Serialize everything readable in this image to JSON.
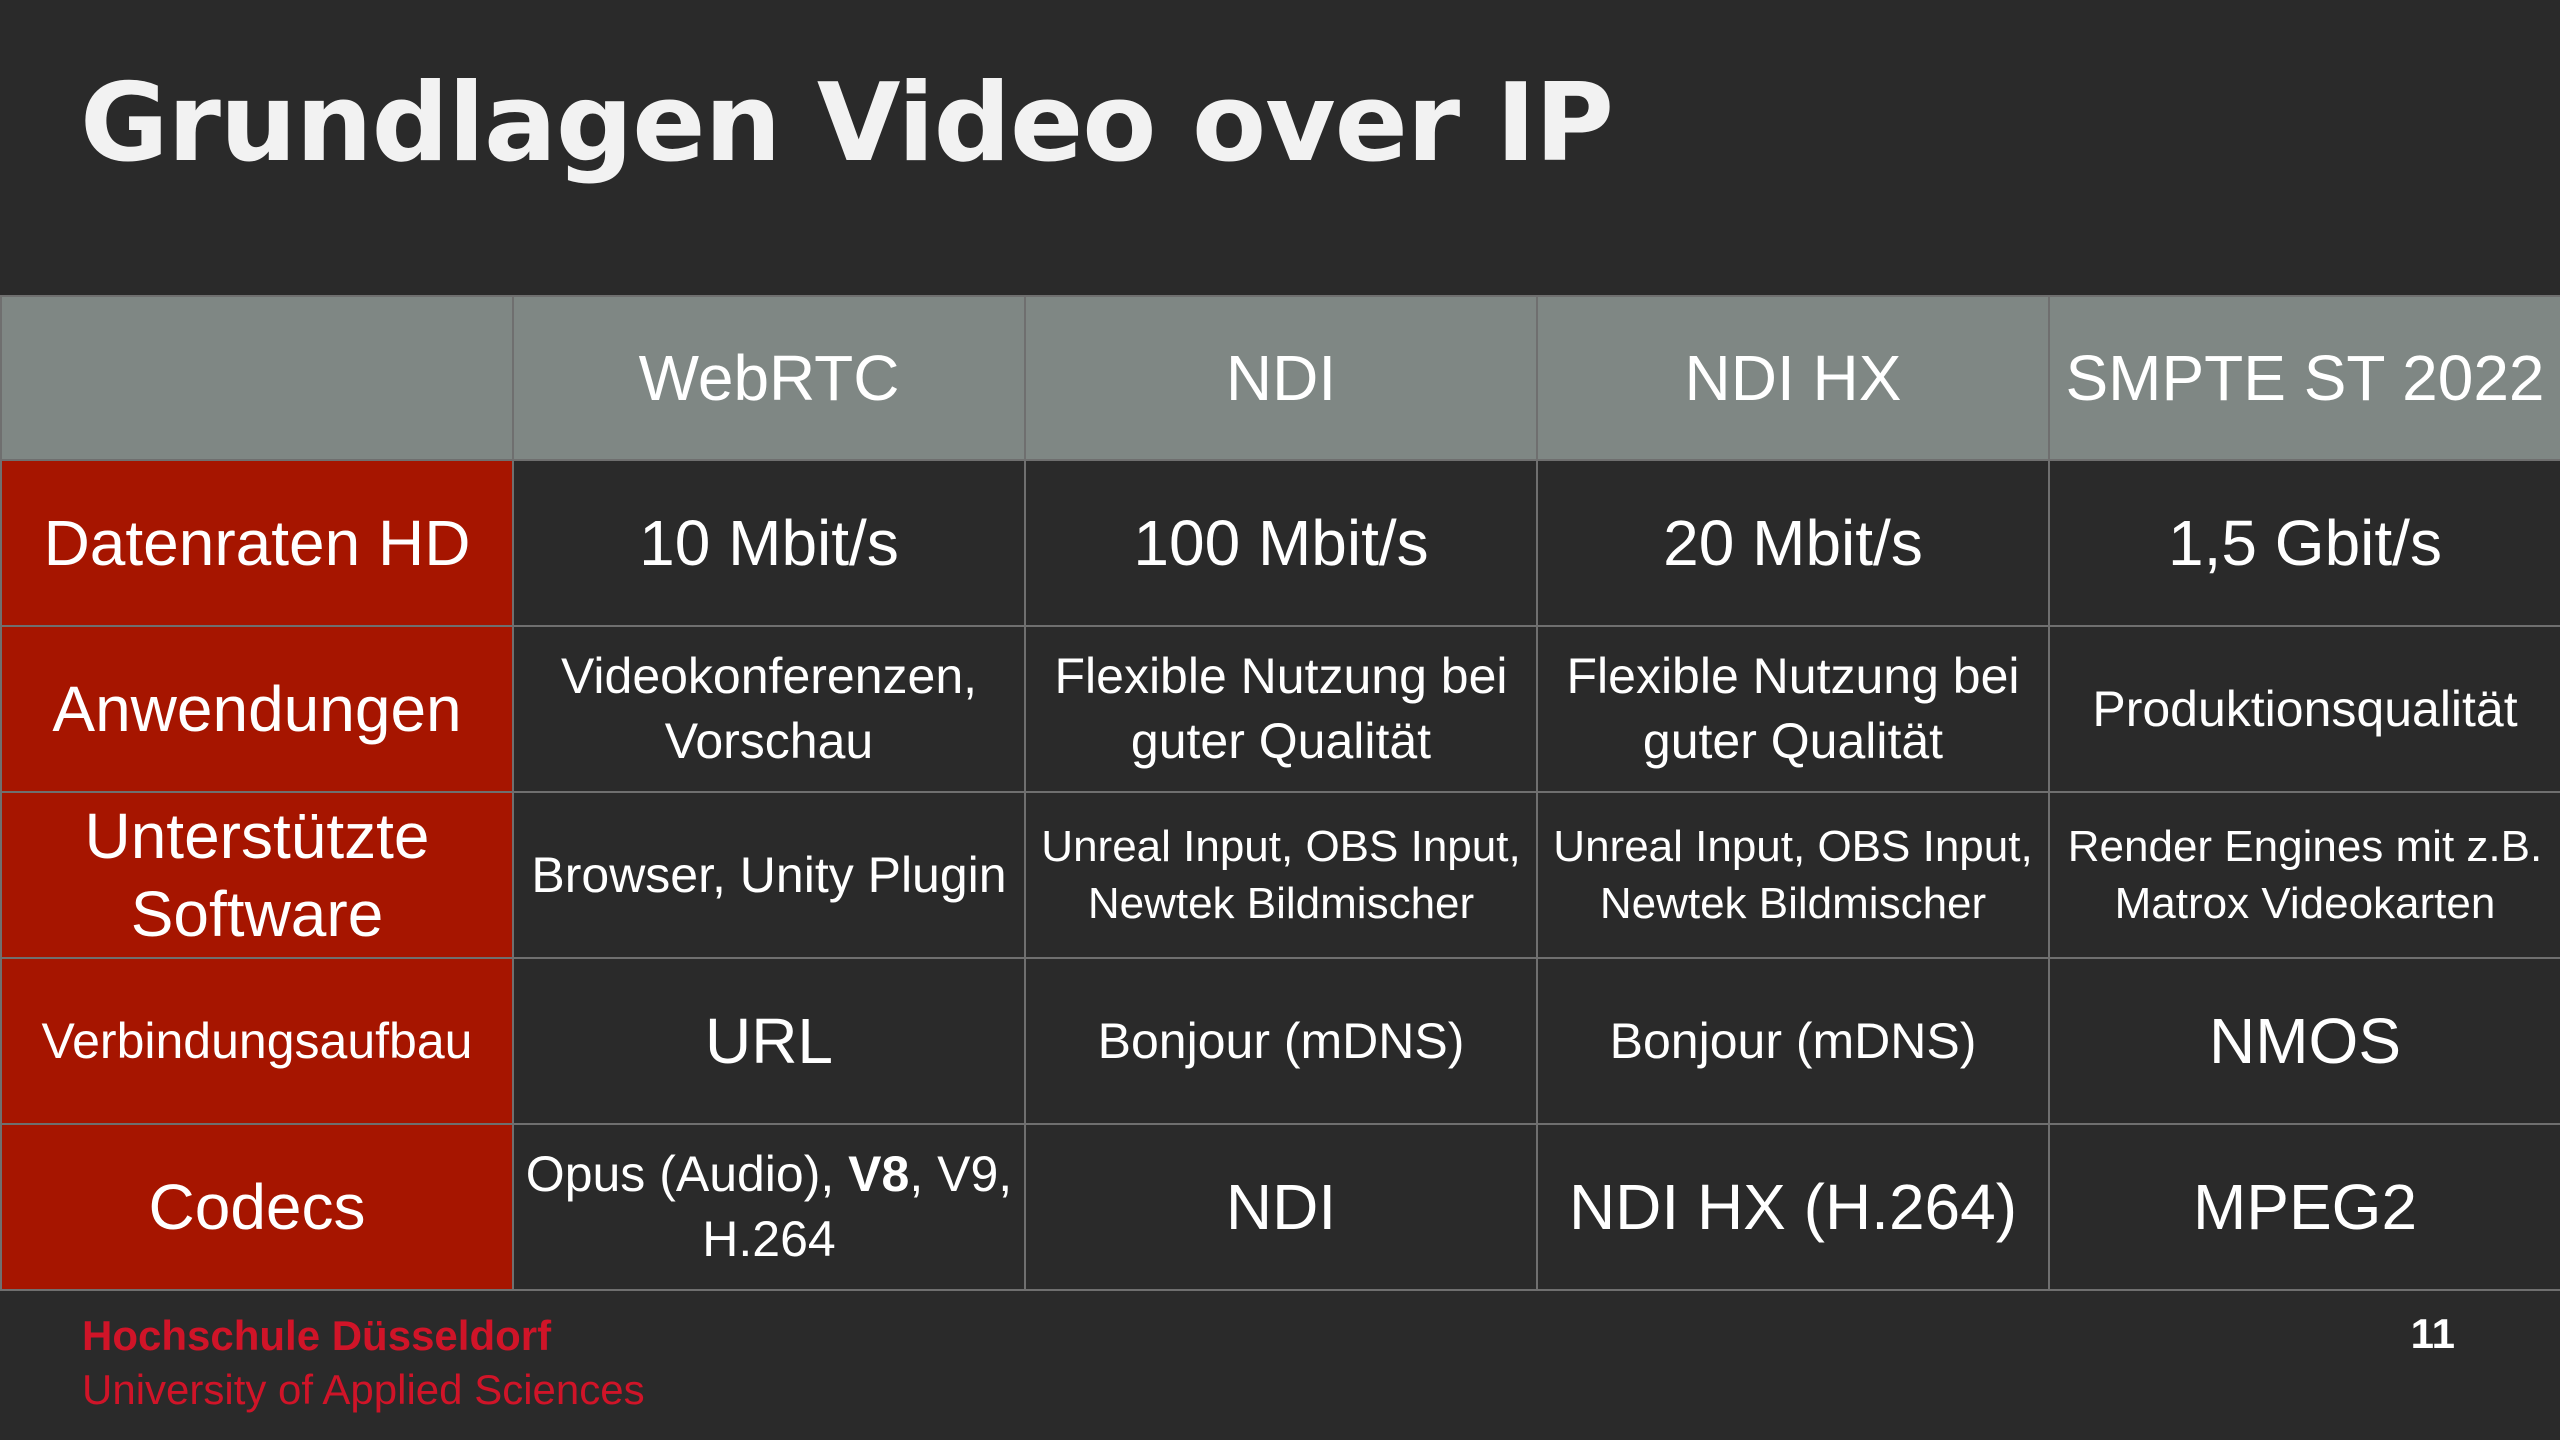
{
  "slide": {
    "title": "Grundlagen Video over IP",
    "page_number": "11"
  },
  "table": {
    "header": {
      "corner": "",
      "columns": [
        "WebRTC",
        "NDI",
        "NDI HX",
        "SMPTE ST 2022"
      ]
    },
    "rows": [
      {
        "label_parts": [
          "Datenraten HD"
        ],
        "cells": [
          {
            "parts": [
              "10 Mbit/s"
            ]
          },
          {
            "parts": [
              "100 Mbit/s"
            ]
          },
          {
            "parts": [
              "20 Mbit/s"
            ]
          },
          {
            "parts": [
              "1,5 Gbit/s"
            ]
          }
        ]
      },
      {
        "label_parts": [
          "Anwendungen"
        ],
        "cells": [
          {
            "parts": [
              "Videokonferenzen,",
              "Vorschau"
            ]
          },
          {
            "parts": [
              "Flexible Nutzung bei",
              "guter Qualität"
            ]
          },
          {
            "parts": [
              "Flexible Nutzung bei",
              "guter Qualität"
            ]
          },
          {
            "parts": [
              "Produktionsqualität"
            ]
          }
        ]
      },
      {
        "label_parts": [
          "Unterstützte",
          "Software"
        ],
        "cells": [
          {
            "parts": [
              "Browser, Unity Plugin"
            ]
          },
          {
            "parts": [
              "Unreal Input, OBS Input,",
              "Newtek Bildmischer"
            ]
          },
          {
            "parts": [
              "Unreal Input, OBS Input,",
              "Newtek Bildmischer"
            ]
          },
          {
            "parts": [
              "Render Engines mit z.B.",
              "Matrox Videokarten"
            ]
          }
        ]
      },
      {
        "label_parts": [
          "Verbindungsaufbau"
        ],
        "cells": [
          {
            "parts": [
              "URL"
            ]
          },
          {
            "parts": [
              "Bonjour (mDNS)"
            ]
          },
          {
            "parts": [
              "Bonjour (mDNS)"
            ]
          },
          {
            "parts": [
              "NMOS"
            ]
          }
        ]
      },
      {
        "label_parts": [
          "Codecs"
        ],
        "cells": [
          {
            "parts": [
              "Opus (Audio), ",
              "V8",
              ", V9,",
              "H.264"
            ]
          },
          {
            "parts": [
              "NDI"
            ]
          },
          {
            "parts": [
              "NDI HX (H.264)"
            ]
          },
          {
            "parts": [
              "MPEG2"
            ]
          }
        ]
      }
    ]
  },
  "footer": {
    "institution": "Hochschule Düsseldorf",
    "subtitle": "University of Applied Sciences"
  },
  "colors": {
    "background": "#2a2a2a",
    "header_row": "#7f8784",
    "row_label": "#a61500",
    "grid_line": "#6f6f6f",
    "footer_text": "#d01428",
    "text": "#ffffff"
  }
}
